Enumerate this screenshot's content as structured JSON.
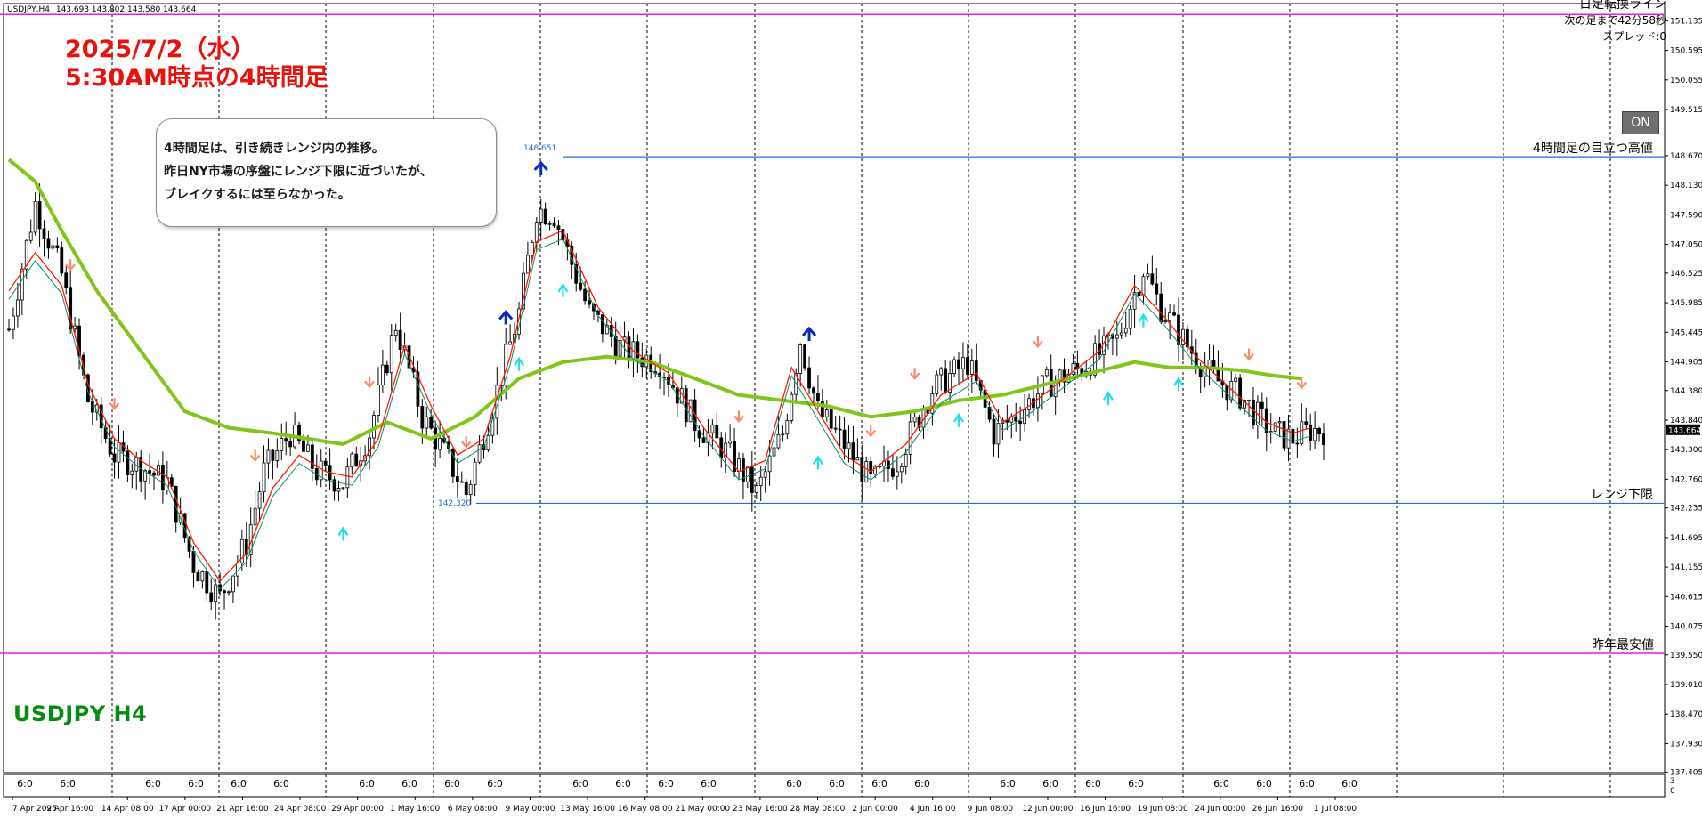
{
  "header": {
    "symbol_tf": "USDJPY,H4",
    "ohlc": "143.693 143.802 143.580 143.664"
  },
  "annotation": {
    "date_line": "2025/7/2（水）",
    "time_line": "5:30AM時点の4時間足"
  },
  "comment": {
    "line1": "4時間足は、引き続きレンジ内の推移。",
    "line2": "昨日NY市場の序盤にレンジ下限に近づいたが、",
    "line3": "ブレイクするには至らなかった。"
  },
  "info_panel": {
    "line1": "日足転換ライン",
    "line2": "次の足まで42分58秒",
    "line3": "スプレッド:0"
  },
  "on_button": "ON",
  "symbol_badge": "USDJPY H4",
  "horizontal_lines": {
    "high": {
      "price": 148.651,
      "price_label": "148.651",
      "label": "4時間足の目立つ高値",
      "color": "#1e6fd9"
    },
    "range_low": {
      "price": 142.32,
      "price_label": "142.320",
      "label": "レンジ下限",
      "color": "#1e6fd9"
    },
    "year_low": {
      "price": 139.58,
      "label": "昨年最安値",
      "color": "#e81ce0"
    },
    "daily_turn": {
      "price": 151.25,
      "color": "#e81ce0"
    }
  },
  "colors": {
    "bull_candle": "#ffffff",
    "bear_candle": "#000000",
    "ma_fast": "#ff1a00",
    "ma_slow": "#0e8c6a",
    "ma_long": "#7fc61a",
    "arrow_up_strong": "#0a2db8",
    "arrow_up": "#1ee0e8",
    "arrow_down": "#ff8a6a",
    "price_tag_bg": "#000000"
  },
  "chart_data": {
    "type": "candlestick",
    "ylim": [
      137.4,
      151.45
    ],
    "y_ticks": [
      "151.135",
      "150.595",
      "150.055",
      "149.515",
      "148.670",
      "148.130",
      "147.590",
      "147.050",
      "146.525",
      "145.985",
      "145.445",
      "144.905",
      "144.380",
      "143.840",
      "143.300",
      "142.760",
      "142.235",
      "141.695",
      "141.155",
      "140.615",
      "140.075",
      "139.550",
      "139.010",
      "138.470",
      "137.930",
      "137.405"
    ],
    "current_price_label": "143.664",
    "x_date_labels": [
      "7 Apr 2025",
      "9 Apr 16:00",
      "14 Apr 08:00",
      "17 Apr 00:00",
      "21 Apr 16:00",
      "24 Apr 08:00",
      "29 Apr 00:00",
      "1 May 16:00",
      "6 May 08:00",
      "9 May 00:00",
      "13 May 16:00",
      "16 May 08:00",
      "21 May 00:00",
      "23 May 16:00",
      "28 May 08:00",
      "2 Jun 00:00",
      "4 Jun 16:00",
      "9 Jun 08:00",
      "12 Jun 00:00",
      "16 Jun 16:00",
      "19 Jun 08:00",
      "24 Jun 00:00",
      "26 Jun 16:00",
      "1 Jul 08:00"
    ],
    "session_label": "6:0",
    "macd_axis": {
      "labels": [
        "3",
        "0"
      ]
    },
    "close_path": [
      [
        0,
        145.5
      ],
      [
        6,
        147.8
      ],
      [
        12,
        146.5
      ],
      [
        18,
        144.2
      ],
      [
        24,
        143.2
      ],
      [
        30,
        143.0
      ],
      [
        36,
        142.7
      ],
      [
        42,
        141.2
      ],
      [
        48,
        140.6
      ],
      [
        54,
        141.6
      ],
      [
        58,
        142.9
      ],
      [
        64,
        143.6
      ],
      [
        70,
        142.9
      ],
      [
        76,
        142.7
      ],
      [
        82,
        143.6
      ],
      [
        88,
        145.6
      ],
      [
        94,
        143.9
      ],
      [
        100,
        143.1
      ],
      [
        104,
        142.5
      ],
      [
        110,
        144.1
      ],
      [
        116,
        145.8
      ],
      [
        120,
        147.7
      ],
      [
        124,
        147.6
      ],
      [
        132,
        145.8
      ],
      [
        140,
        145.1
      ],
      [
        148,
        144.9
      ],
      [
        156,
        143.8
      ],
      [
        164,
        143.2
      ],
      [
        170,
        142.5
      ],
      [
        176,
        143.6
      ],
      [
        180,
        145.3
      ],
      [
        184,
        144.0
      ],
      [
        190,
        143.4
      ],
      [
        196,
        142.7
      ],
      [
        202,
        143.1
      ],
      [
        210,
        144.4
      ],
      [
        218,
        144.9
      ],
      [
        224,
        143.6
      ],
      [
        230,
        144.0
      ],
      [
        236,
        144.5
      ],
      [
        244,
        144.8
      ],
      [
        252,
        145.3
      ],
      [
        258,
        146.6
      ],
      [
        262,
        145.9
      ],
      [
        268,
        145.2
      ],
      [
        274,
        144.6
      ],
      [
        280,
        144.3
      ],
      [
        284,
        143.9
      ],
      [
        288,
        143.6
      ],
      [
        292,
        143.5
      ],
      [
        296,
        143.66
      ]
    ],
    "fast_ma_path": [
      [
        0,
        146.2
      ],
      [
        6,
        146.9
      ],
      [
        12,
        146.3
      ],
      [
        18,
        144.5
      ],
      [
        24,
        143.5
      ],
      [
        30,
        143.1
      ],
      [
        36,
        142.8
      ],
      [
        42,
        141.6
      ],
      [
        48,
        140.9
      ],
      [
        54,
        141.4
      ],
      [
        60,
        142.6
      ],
      [
        66,
        143.2
      ],
      [
        72,
        142.9
      ],
      [
        78,
        142.8
      ],
      [
        84,
        143.5
      ],
      [
        90,
        145.2
      ],
      [
        96,
        144.1
      ],
      [
        102,
        143.2
      ],
      [
        108,
        143.5
      ],
      [
        114,
        145.0
      ],
      [
        120,
        147.1
      ],
      [
        126,
        147.3
      ],
      [
        134,
        145.9
      ],
      [
        142,
        145.1
      ],
      [
        150,
        144.7
      ],
      [
        158,
        143.7
      ],
      [
        166,
        142.9
      ],
      [
        172,
        143.1
      ],
      [
        178,
        144.8
      ],
      [
        184,
        144.0
      ],
      [
        190,
        143.2
      ],
      [
        196,
        142.9
      ],
      [
        204,
        143.4
      ],
      [
        212,
        144.3
      ],
      [
        220,
        144.7
      ],
      [
        226,
        143.8
      ],
      [
        232,
        144.1
      ],
      [
        240,
        144.6
      ],
      [
        248,
        145.1
      ],
      [
        256,
        146.3
      ],
      [
        262,
        145.8
      ],
      [
        270,
        145.0
      ],
      [
        278,
        144.4
      ],
      [
        286,
        143.8
      ],
      [
        292,
        143.6
      ],
      [
        296,
        143.7
      ]
    ],
    "long_ma_path": [
      [
        0,
        148.6
      ],
      [
        6,
        148.2
      ],
      [
        12,
        147.3
      ],
      [
        20,
        146.2
      ],
      [
        30,
        145.1
      ],
      [
        40,
        144.0
      ],
      [
        50,
        143.7
      ],
      [
        60,
        143.6
      ],
      [
        68,
        143.5
      ],
      [
        76,
        143.4
      ],
      [
        86,
        143.8
      ],
      [
        96,
        143.5
      ],
      [
        106,
        143.9
      ],
      [
        116,
        144.6
      ],
      [
        126,
        144.9
      ],
      [
        136,
        145.0
      ],
      [
        146,
        144.9
      ],
      [
        156,
        144.6
      ],
      [
        166,
        144.3
      ],
      [
        176,
        144.2
      ],
      [
        186,
        144.1
      ],
      [
        196,
        143.9
      ],
      [
        206,
        144.0
      ],
      [
        216,
        144.2
      ],
      [
        226,
        144.3
      ],
      [
        236,
        144.5
      ],
      [
        246,
        144.7
      ],
      [
        256,
        144.9
      ],
      [
        264,
        144.8
      ],
      [
        272,
        144.8
      ],
      [
        280,
        144.75
      ],
      [
        288,
        144.65
      ],
      [
        294,
        144.6
      ]
    ],
    "signal_arrows": [
      {
        "i": 14,
        "dir": "down",
        "strength": "normal"
      },
      {
        "i": 24,
        "dir": "down",
        "strength": "normal"
      },
      {
        "i": 56,
        "dir": "down",
        "strength": "normal"
      },
      {
        "i": 82,
        "dir": "down",
        "strength": "normal"
      },
      {
        "i": 104,
        "dir": "down",
        "strength": "normal"
      },
      {
        "i": 76,
        "dir": "up",
        "strength": "normal"
      },
      {
        "i": 116,
        "dir": "up",
        "strength": "normal"
      },
      {
        "i": 113,
        "dir": "up",
        "strength": "strong"
      },
      {
        "i": 121,
        "dir": "up",
        "strength": "strong"
      },
      {
        "i": 126,
        "dir": "up",
        "strength": "normal"
      },
      {
        "i": 166,
        "dir": "down",
        "strength": "normal"
      },
      {
        "i": 182,
        "dir": "up",
        "strength": "strong"
      },
      {
        "i": 184,
        "dir": "up",
        "strength": "normal"
      },
      {
        "i": 196,
        "dir": "down",
        "strength": "normal"
      },
      {
        "i": 206,
        "dir": "down",
        "strength": "normal"
      },
      {
        "i": 216,
        "dir": "up",
        "strength": "normal"
      },
      {
        "i": 234,
        "dir": "down",
        "strength": "normal"
      },
      {
        "i": 250,
        "dir": "up",
        "strength": "normal"
      },
      {
        "i": 258,
        "dir": "up",
        "strength": "normal"
      },
      {
        "i": 266,
        "dir": "up",
        "strength": "normal"
      },
      {
        "i": 282,
        "dir": "down",
        "strength": "normal"
      },
      {
        "i": 294,
        "dir": "down",
        "strength": "normal"
      }
    ]
  }
}
